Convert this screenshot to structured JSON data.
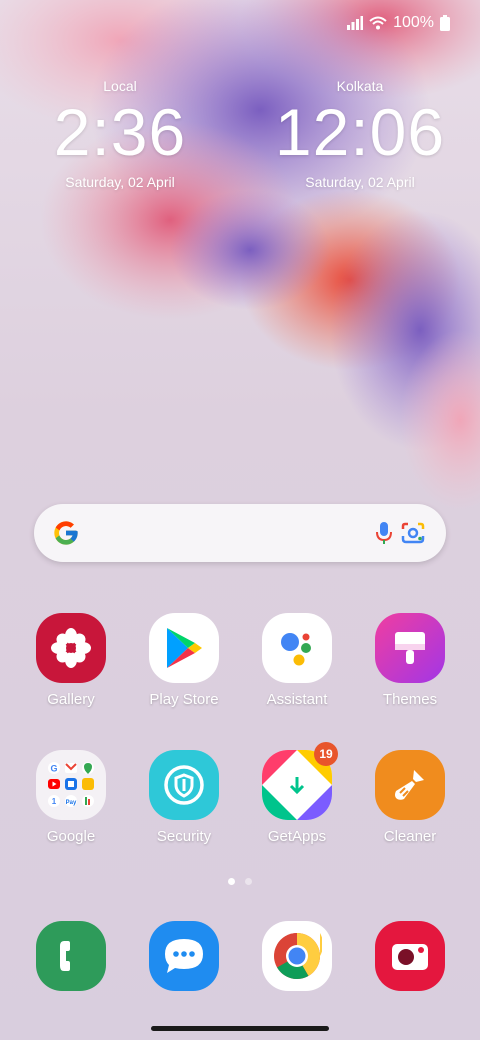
{
  "status": {
    "battery": "100%"
  },
  "clocks": [
    {
      "city": "Local",
      "time": "2:36",
      "date": "Saturday, 02 April"
    },
    {
      "city": "Kolkata",
      "time": "12:06",
      "date": "Saturday, 02 April"
    }
  ],
  "apps_row1": [
    {
      "label": "Gallery",
      "icon": "gallery-icon"
    },
    {
      "label": "Play Store",
      "icon": "play-store-icon"
    },
    {
      "label": "Assistant",
      "icon": "assistant-icon"
    },
    {
      "label": "Themes",
      "icon": "themes-icon"
    }
  ],
  "apps_row2": [
    {
      "label": "Google",
      "icon": "google-folder-icon"
    },
    {
      "label": "Security",
      "icon": "security-icon"
    },
    {
      "label": "GetApps",
      "icon": "getapps-icon",
      "badge": "19"
    },
    {
      "label": "Cleaner",
      "icon": "cleaner-icon"
    }
  ],
  "dock": [
    {
      "icon": "phone-icon"
    },
    {
      "icon": "messages-icon"
    },
    {
      "icon": "chrome-icon"
    },
    {
      "icon": "camera-icon"
    }
  ],
  "page_indicator": {
    "current": 1,
    "total": 2
  }
}
